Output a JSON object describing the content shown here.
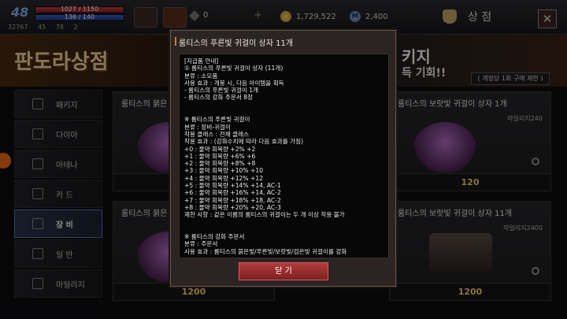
{
  "header": {
    "level": "48",
    "hp": "1027 / 1150",
    "mp": "136 / 140",
    "stats": [
      "32767",
      "45",
      "78",
      "2"
    ],
    "slot_badge": "167",
    "crystal": "0",
    "gold": "1,729,522",
    "mileage_symbol": "M",
    "mileage": "2,400",
    "shop_title": "상 점",
    "close_glyph": "✕"
  },
  "banner": {
    "title": "판도라상점",
    "right_line1": "키지",
    "right_line2": "득 기회!!",
    "note": "( 계정당 1회 구매 제한 )"
  },
  "sidebar": {
    "items": [
      {
        "label": "패키지"
      },
      {
        "label": "다이아"
      },
      {
        "label": "아테나"
      },
      {
        "label": "카 드"
      },
      {
        "label": "장 비"
      },
      {
        "label": "일 반"
      },
      {
        "label": "마일리지"
      }
    ],
    "active_index": 4
  },
  "cards": [
    {
      "name": "룸티스의 붉은",
      "sub": "",
      "price": ""
    },
    {
      "name": "룸티스의 보랏빛 귀걸이 상자 1개",
      "sub": "마일리지240",
      "price": "120"
    },
    {
      "name": "룸티스의 붉은",
      "sub": "",
      "price": "1200"
    },
    {
      "name": "룸티스의 보랏빛 귀걸이 상자 11개",
      "sub": "마일리지2400",
      "price": "1200"
    }
  ],
  "modal": {
    "title": "룸티스의 푸른빛 귀걸이 상자 11개",
    "body": "[지급품 안내]\n① 룸티스의 푸른빛 귀걸이 상자 (11개)\n분류 : 소모품\n사용 효과 : 개봉 시, 다음 아이템을 획득\n- 룸티스의 푸른빛 귀걸이 1개\n- 룸티스의 강화 주문서 8장\n\n\n※ 룸티스의 푸른빛 귀걸이\n분류 : 장비-귀걸이\n착용 클래스 : 전체 클래스\n착용 효과 : (강화수치에 따라 다음 효과를 가짐)\n+0 : 물약 회복량 +2% +2\n+1 : 물약 회복량 +6% +6\n+2 : 물약 회복량 +8% +8\n+3 : 물약 회복량 +10% +10\n+4 : 물약 회복량 +12% +12\n+5 : 물약 회복량 +14% +14, AC-1\n+6 : 물약 회복량 +16% +14, AC-2\n+7 : 물약 회복량 +18% +18, AC-2\n+8 : 물약 회복량 +20% +20, AC-3\n제한 사항 : 같은 이름의 룸티스의 귀걸이는 두 개 이상 착용 불가\n\n\n※ 룸티스의 강화 주문서\n분류 : 주문서\n사용 효과 : 룸티스의 붉은빛/푸른빛/보랏빛/검은빛 귀걸이를 강화",
    "confirm_label": "닫 기"
  }
}
